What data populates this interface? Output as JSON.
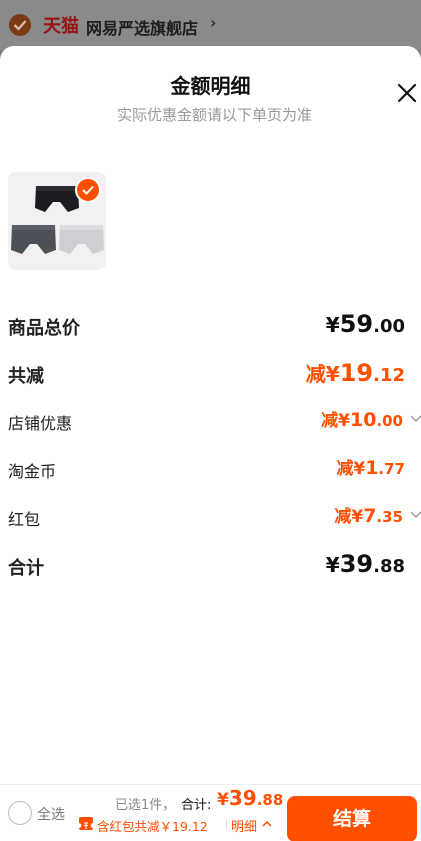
{
  "store": {
    "brand": "天猫",
    "name": "网易严选旗舰店",
    "chevron": "›"
  },
  "sheet": {
    "title": "金额明细",
    "subtitle": "实际优惠金额请以下单页为准"
  },
  "breakdown": {
    "goods_total": {
      "label": "商品总价",
      "prefix": "¥",
      "int": "59",
      "dec": ".00"
    },
    "total_reduction": {
      "label": "共减",
      "prefix": "减¥",
      "int": "19",
      "dec": ".12"
    },
    "shop_discount": {
      "label": "店铺优惠",
      "prefix": "减¥",
      "int": "10",
      "dec": ".00"
    },
    "taojinbi": {
      "label": "淘金币",
      "prefix": "减¥",
      "int": "1",
      "dec": ".77"
    },
    "red_packet": {
      "label": "红包",
      "prefix": "减¥",
      "int": "7",
      "dec": ".35"
    },
    "sum": {
      "label": "合计",
      "prefix": "¥",
      "int": "39",
      "dec": ".88"
    }
  },
  "bottom_bar": {
    "select_all": "全选",
    "selected_count": "已选1件，",
    "total_label": "合计:",
    "total_prefix": "¥",
    "total_int": "39",
    "total_dec": ".88",
    "discount_text": "含红包共减￥19.12",
    "detail_link": "明细",
    "checkout": "结算"
  },
  "colors": {
    "accent": "#ff5000",
    "text": "#111111",
    "muted": "#999999"
  }
}
